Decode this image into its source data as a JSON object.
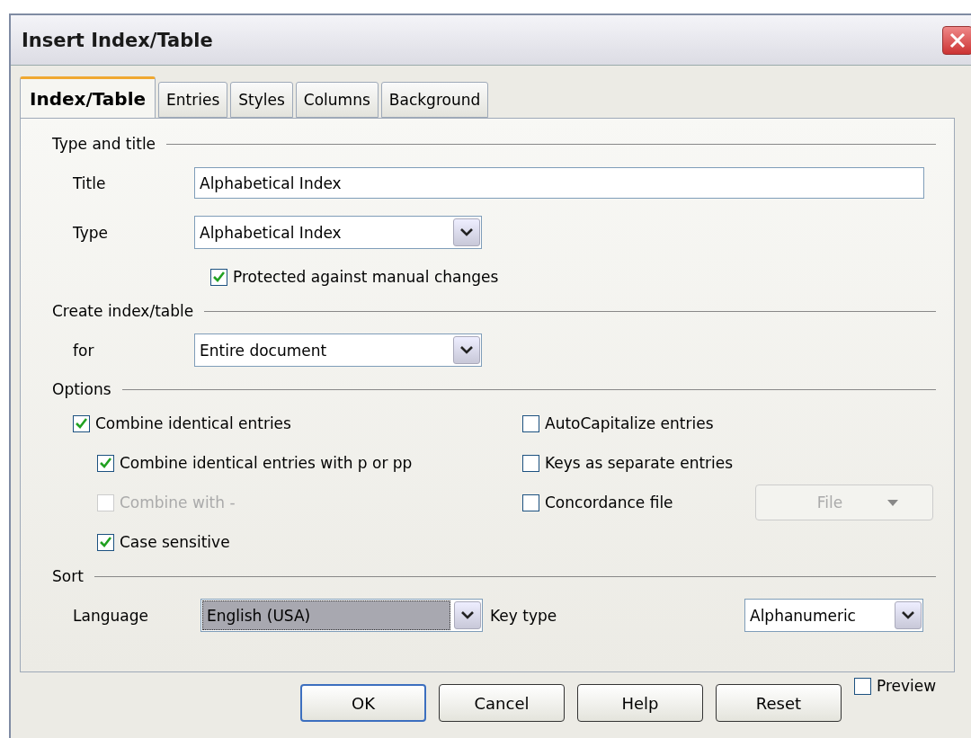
{
  "window": {
    "title": "Insert Index/Table"
  },
  "tabs": [
    {
      "label": "Index/Table",
      "selected": true
    },
    {
      "label": "Entries",
      "selected": false
    },
    {
      "label": "Styles",
      "selected": false
    },
    {
      "label": "Columns",
      "selected": false
    },
    {
      "label": "Background",
      "selected": false
    }
  ],
  "type_and_title": {
    "heading": "Type and title",
    "title_label": "Title",
    "title_value": "Alphabetical Index",
    "type_label": "Type",
    "type_value": "Alphabetical Index",
    "protected": {
      "label": "Protected against manual changes",
      "checked": true,
      "disabled": false
    }
  },
  "create": {
    "heading": "Create index/table",
    "for_label": "for",
    "for_value": "Entire document"
  },
  "options": {
    "heading": "Options",
    "left": [
      {
        "label": "Combine identical entries",
        "checked": true,
        "disabled": false,
        "children": [
          {
            "label": "Combine identical entries with p or pp",
            "checked": true,
            "disabled": false
          },
          {
            "label": "Combine with -",
            "checked": false,
            "disabled": true
          },
          {
            "label": "Case sensitive",
            "checked": true,
            "disabled": false
          }
        ]
      }
    ],
    "right": [
      {
        "label": "AutoCapitalize entries",
        "checked": false,
        "disabled": false
      },
      {
        "label": "Keys as separate entries",
        "checked": false,
        "disabled": false
      },
      {
        "label": "Concordance file",
        "checked": false,
        "disabled": false,
        "file_button": {
          "label": "File",
          "disabled": true
        }
      }
    ]
  },
  "sort": {
    "heading": "Sort",
    "language_label": "Language",
    "language_value": "English (USA)",
    "language_focused": true,
    "key_type_label": "Key type",
    "key_type_value": "Alphanumeric"
  },
  "buttons": [
    {
      "label": "OK",
      "kind": "default"
    },
    {
      "label": "Cancel",
      "kind": "normal"
    },
    {
      "label": "Help",
      "kind": "normal"
    },
    {
      "label": "Reset",
      "kind": "normal"
    }
  ],
  "preview": {
    "label": "Preview",
    "checked": false
  }
}
